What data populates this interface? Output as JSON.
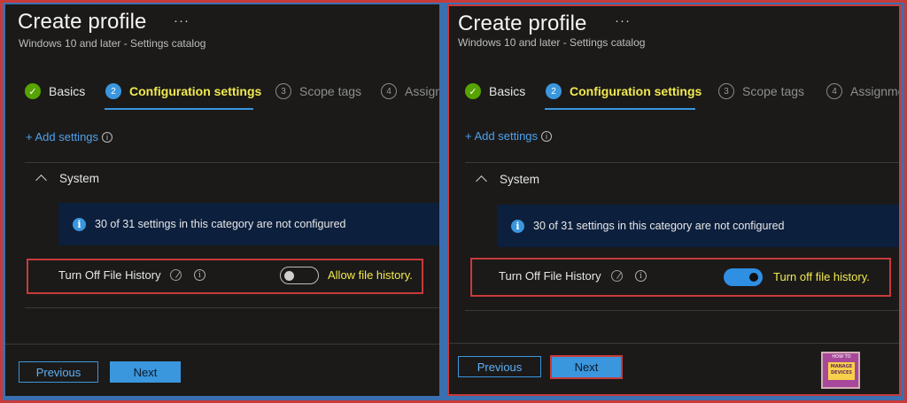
{
  "left": {
    "title": "Create profile",
    "more": "···",
    "subtitle": "Windows 10 and later - Settings catalog",
    "steps": [
      {
        "num": "✓",
        "label": "Basics"
      },
      {
        "num": "2",
        "label": "Configuration settings"
      },
      {
        "num": "3",
        "label": "Scope tags"
      },
      {
        "num": "4",
        "label": "Assign"
      }
    ],
    "add_settings": "+ Add settings",
    "section": "System",
    "info_text": "30 of 31 settings in this category are not configured",
    "setting_name": "Turn Off File History",
    "toggle_state": "off",
    "toggle_label": "Allow file history.",
    "prev_label": "Previous",
    "next_label": "Next"
  },
  "right": {
    "title": "Create profile",
    "more": "···",
    "subtitle": "Windows 10 and later - Settings catalog",
    "steps": [
      {
        "num": "✓",
        "label": "Basics"
      },
      {
        "num": "2",
        "label": "Configuration settings"
      },
      {
        "num": "3",
        "label": "Scope tags"
      },
      {
        "num": "4",
        "label": "Assignme"
      }
    ],
    "add_settings": "+ Add settings",
    "section": "System",
    "info_text": "30 of 31 settings in this category are not configured",
    "setting_name": "Turn Off File History",
    "toggle_state": "on",
    "toggle_label": "Turn off file history.",
    "prev_label": "Previous",
    "next_label": "Next"
  },
  "logo": {
    "line1": "HOW TO",
    "line2": "MANAGE",
    "line3": "DEVICES"
  },
  "colors": {
    "accent": "#3a96dd",
    "highlight": "#f2e94e",
    "annotation": "#c83a3a",
    "done": "#57a300"
  }
}
